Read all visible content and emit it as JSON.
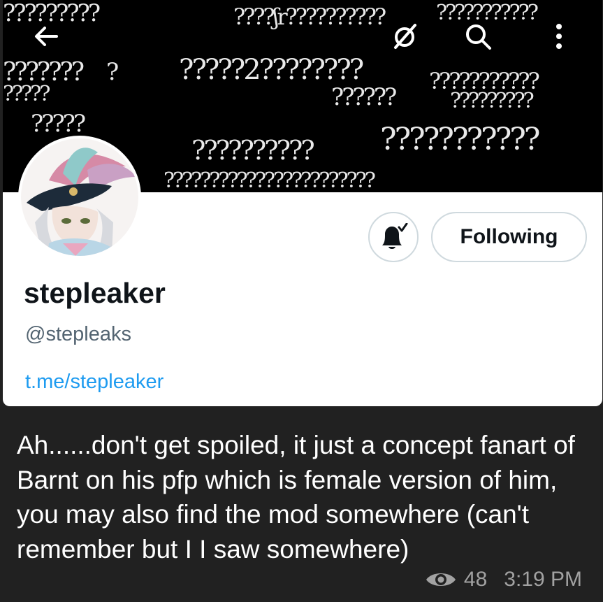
{
  "profile": {
    "display_name": "stepleaker",
    "handle": "@stepleaks",
    "link": "t.me/stepleaker",
    "follow_button": "Following"
  },
  "toolbar": {
    "icons": [
      "back-arrow-icon",
      "grok-icon",
      "search-icon",
      "more-vertical-icon"
    ]
  },
  "message": {
    "text": "Ah......don't get spoiled, it just a concept fanart of Barnt on his pfp which is female version of him, you may also find the mod somewhere (can't remember but I I saw somewhere)",
    "views": "48",
    "time": "3:19 PM"
  },
  "colors": {
    "chat_background": "#212121",
    "link": "#1d9bf0",
    "meta": "#a2a2a2"
  }
}
